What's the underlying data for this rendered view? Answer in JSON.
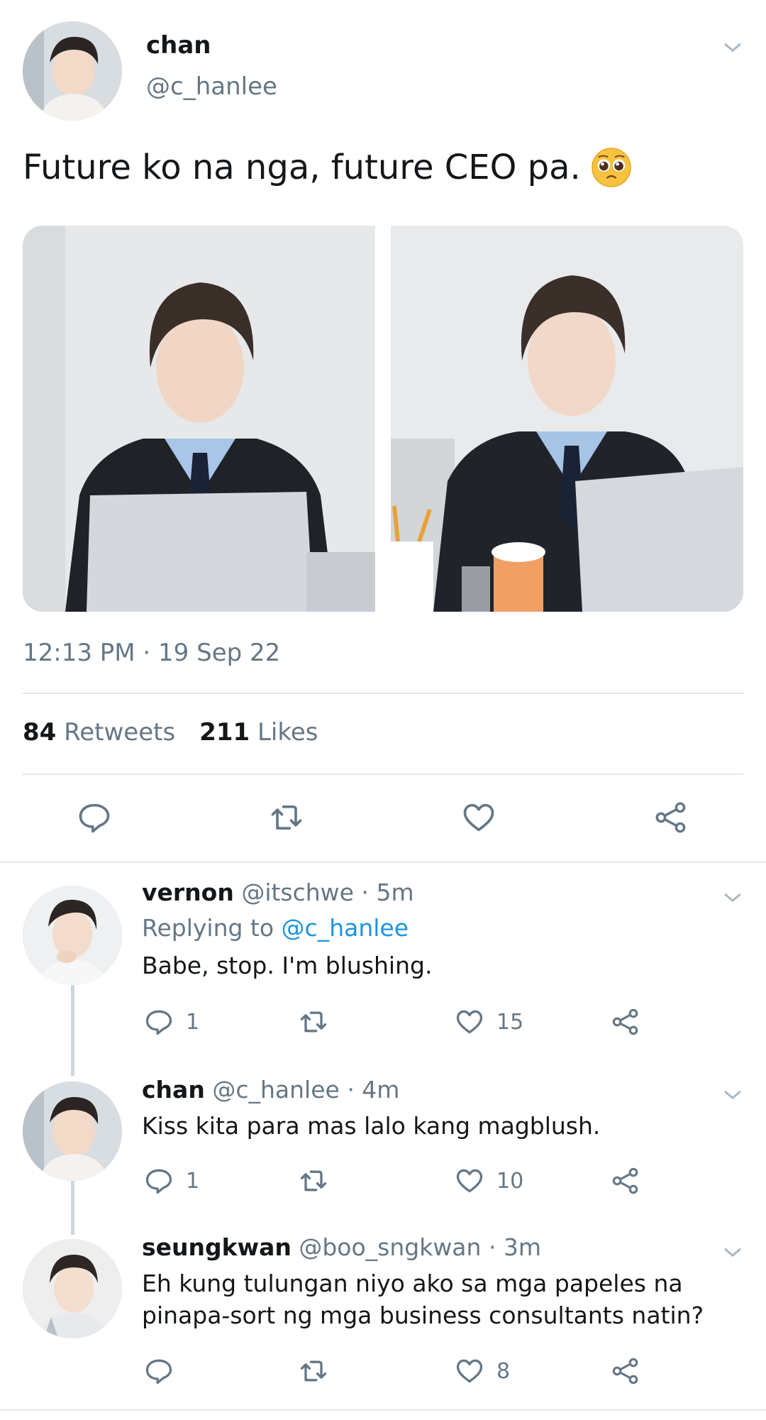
{
  "main_tweet": {
    "name": "chan",
    "handle": "@c_hanlee",
    "text": "Future ko na nga, future CEO pa.",
    "emoji_icon": "pleading-face-emoji",
    "timestamp": "12:13 PM · 19 Sep 22",
    "retweets_count": "84",
    "retweets_label": "Retweets",
    "likes_count": "211",
    "likes_label": "Likes"
  },
  "replies": [
    {
      "name": "vernon",
      "handle": "@itschwe",
      "time": "· 5m",
      "replying_prefix": "Replying to",
      "replying_handle": "@c_hanlee",
      "text": "Babe, stop. I'm blushing.",
      "reply_count": "1",
      "like_count": "15"
    },
    {
      "name": "chan",
      "handle": "@c_hanlee",
      "time": "· 4m",
      "text": "Kiss kita para mas lalo kang magblush.",
      "reply_count": "1",
      "like_count": "10"
    },
    {
      "name": "seungkwan",
      "handle": "@boo_sngkwan",
      "time": "· 3m",
      "text_line1": "Eh kung tulungan niyo ako sa mga papeles na",
      "text_line2": "pinapa-sort ng mga business consultants natin?",
      "like_count": "8"
    }
  ],
  "colors": {
    "text": "#14171a",
    "muted": "#657786",
    "link": "#1b95e0",
    "divider": "#e1e8ed"
  }
}
